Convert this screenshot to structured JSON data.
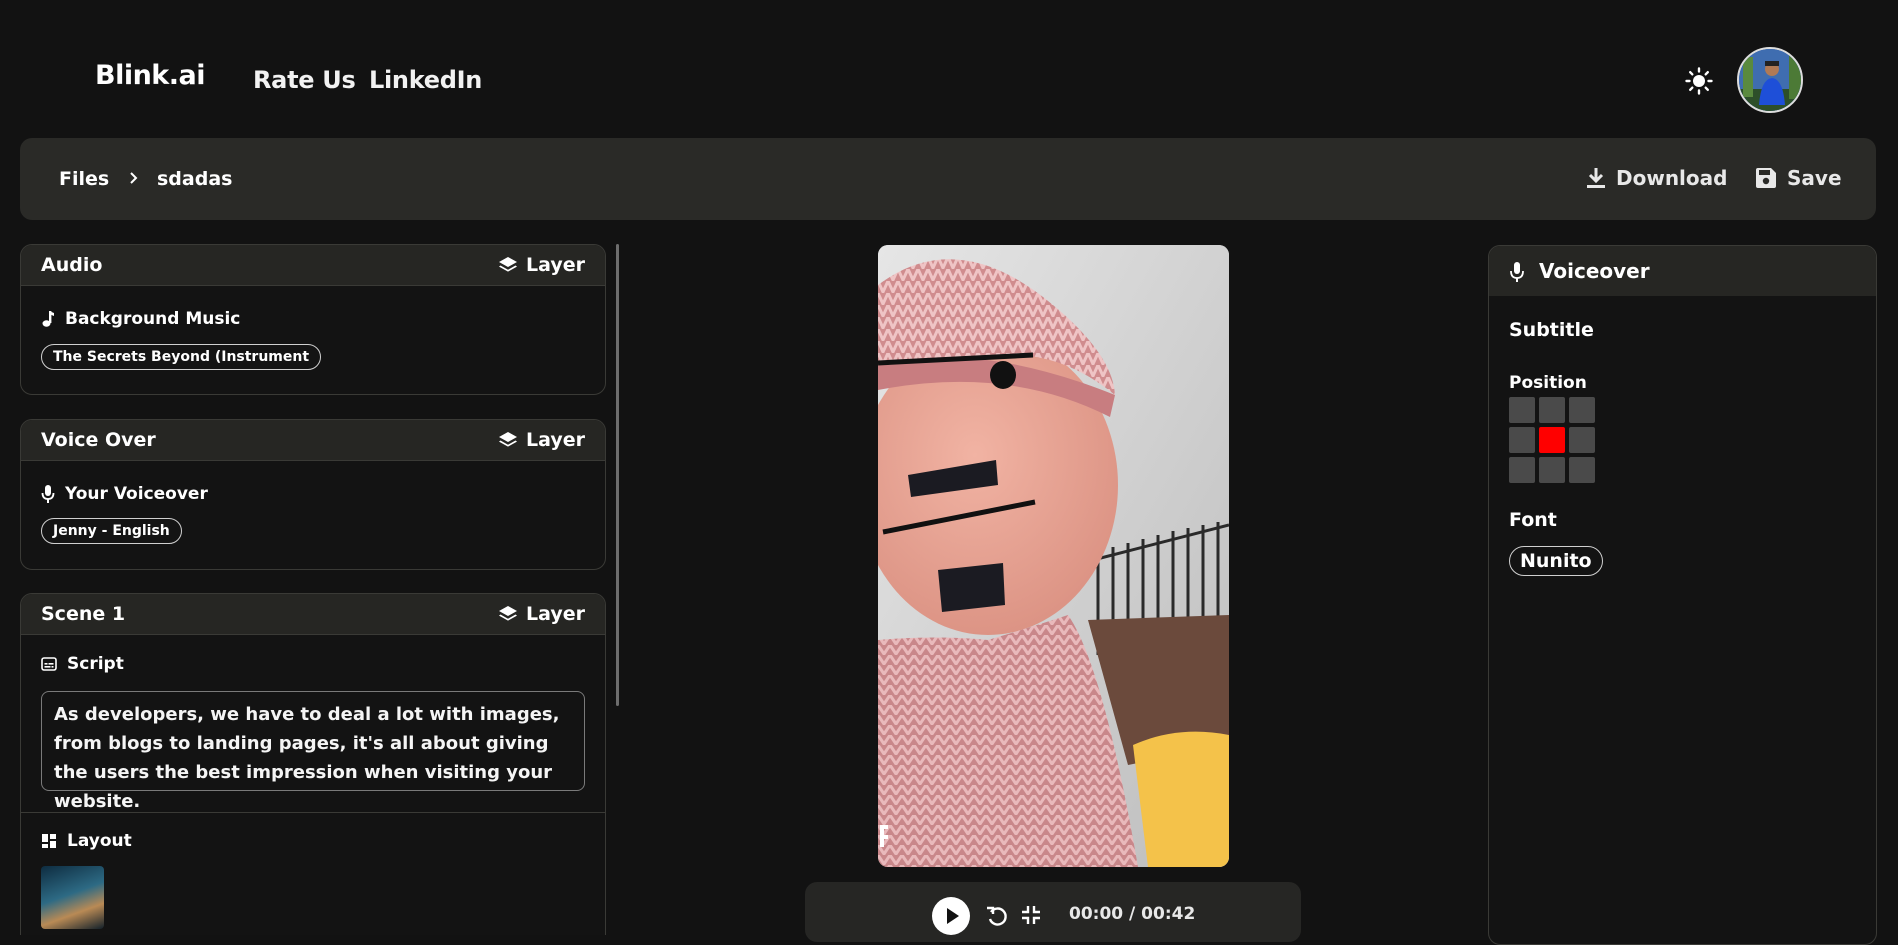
{
  "header": {
    "brand": "Blink.ai",
    "nav": [
      "Rate Us",
      "LinkedIn"
    ]
  },
  "breadcrumb": {
    "root": "Files",
    "current": "sdadas"
  },
  "actions": {
    "download": "Download",
    "save": "Save"
  },
  "left_panel": {
    "audio": {
      "title": "Audio",
      "layer": "Layer",
      "row_label": "Background Music",
      "value": "The Secrets Beyond (Instrument"
    },
    "voice_over": {
      "title": "Voice Over",
      "layer": "Layer",
      "row_label": "Your Voiceover",
      "value": "Jenny - English"
    },
    "scene": {
      "title": "Scene 1",
      "layer": "Layer",
      "script_label": "Script",
      "script_text": "As developers, we have to deal a lot with images, from blogs to landing pages, it's all about giving the users the best impression when visiting your website.",
      "layout_label": "Layout"
    }
  },
  "player": {
    "time": "00:00 / 00:42"
  },
  "right_panel": {
    "title": "Voiceover",
    "subtitle_label": "Subtitle",
    "position_label": "Position",
    "position_grid": [
      0,
      0,
      0,
      0,
      1,
      0,
      0,
      0,
      0
    ],
    "font_label": "Font",
    "font_value": "Nunito"
  },
  "colors": {
    "background": "#121212",
    "panel": "#262623",
    "active_position": "#ff0000"
  }
}
